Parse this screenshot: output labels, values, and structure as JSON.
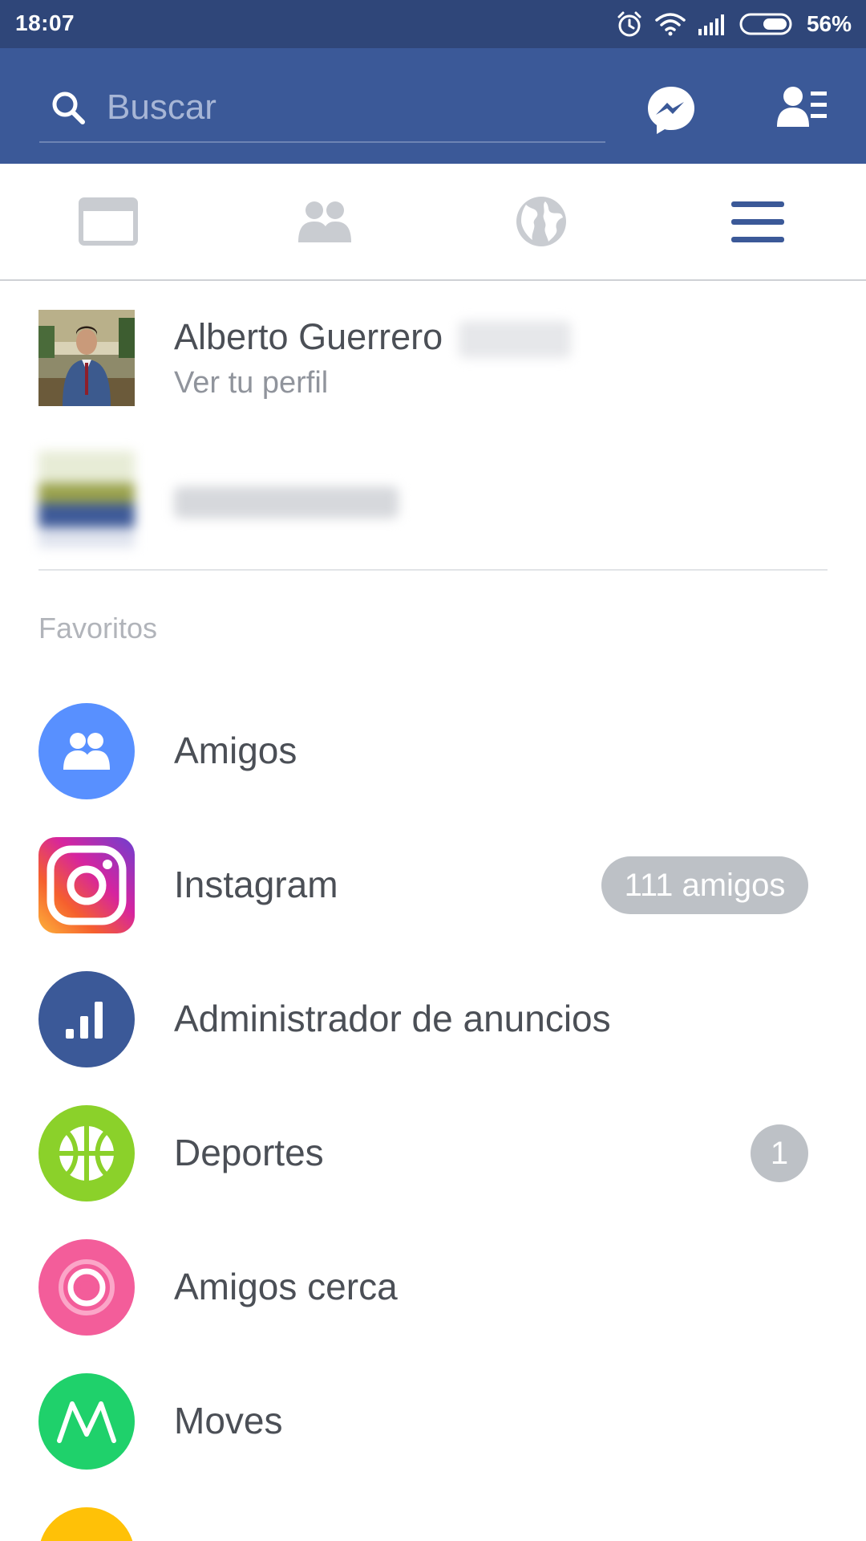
{
  "status_bar": {
    "time": "18:07",
    "battery": "56%",
    "icons": [
      "alarm-icon",
      "wifi-icon",
      "signal-icon",
      "battery-icon"
    ]
  },
  "top_bar": {
    "search_placeholder": "Buscar",
    "icons": [
      "search-icon",
      "messenger-icon",
      "friend-requests-icon"
    ],
    "color": "#3b5998"
  },
  "tabs": [
    {
      "name": "news-feed",
      "icon": "news-feed-icon",
      "active": false
    },
    {
      "name": "friends",
      "icon": "friends-icon",
      "active": false
    },
    {
      "name": "notifications",
      "icon": "globe-icon",
      "active": false
    },
    {
      "name": "menu",
      "icon": "hamburger-menu-icon",
      "active": true
    }
  ],
  "profile": {
    "name": "Alberto Guerrero",
    "subtitle": "Ver tu perfil"
  },
  "favorites": {
    "title": "Favoritos",
    "items": [
      {
        "label": "Amigos",
        "icon": "friends-icon",
        "color": "#5890ff",
        "badge": ""
      },
      {
        "label": "Instagram",
        "icon": "instagram-icon",
        "color": "#d6249f",
        "badge": "111 amigos"
      },
      {
        "label": "Administrador de anuncios",
        "icon": "bar-chart-icon",
        "color": "#3b5998",
        "badge": ""
      },
      {
        "label": "Deportes",
        "icon": "sports-ball-icon",
        "color": "#8bd12a",
        "badge": "1"
      },
      {
        "label": "Amigos cerca",
        "icon": "nearby-friends-icon",
        "color": "#f35d9a",
        "badge": ""
      },
      {
        "label": "Moves",
        "icon": "moves-icon",
        "color": "#1fd16b",
        "badge": ""
      }
    ]
  }
}
